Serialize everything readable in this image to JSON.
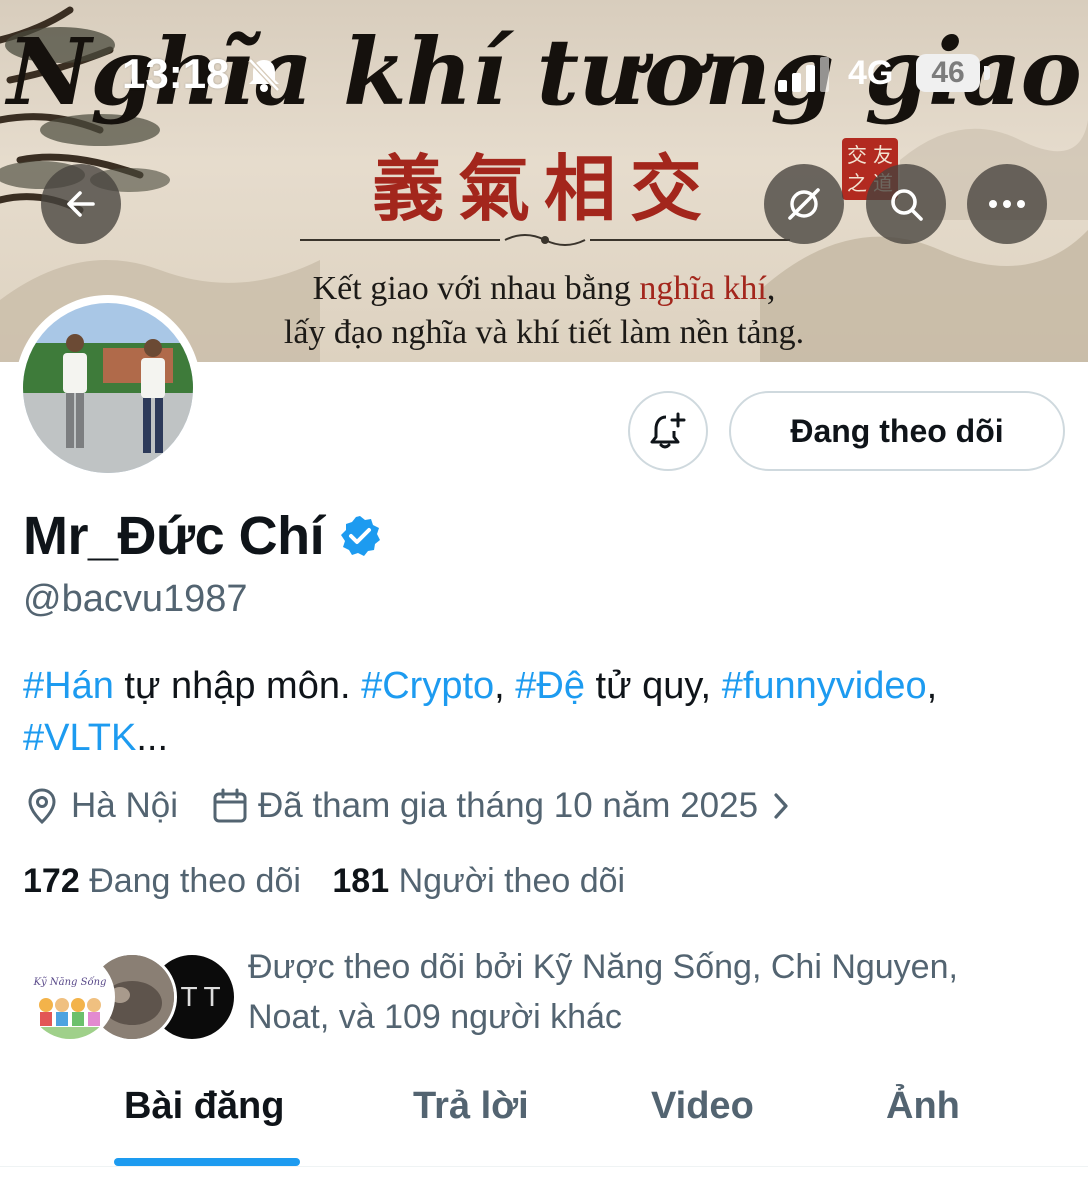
{
  "status_bar": {
    "time": "13:18",
    "network": "4G",
    "battery": "46"
  },
  "banner": {
    "title": "Nghĩa khí tương giao",
    "hanzi": "義氣相交",
    "seal_chars": [
      "交",
      "友",
      "之",
      "道"
    ],
    "line1_prefix": "Kết giao với nhau bằng ",
    "line1_highlight": "nghĩa khí",
    "line1_suffix": ",",
    "line2": "lấy đạo nghĩa và khí tiết làm nền tảng."
  },
  "nav": {
    "back_icon": "arrow-left-icon",
    "grok_icon": "grok-icon",
    "search_icon": "search-icon",
    "more_icon": "more-icon"
  },
  "actions": {
    "notify_icon": "bell-plus-icon",
    "following_label": "Đang theo dõi"
  },
  "profile": {
    "name": "Mr_Đức Chí",
    "handle": "@bacvu1987",
    "bio": [
      {
        "text": "#Hán",
        "tag": true
      },
      {
        "text": " tự nhập môn. ",
        "tag": false
      },
      {
        "text": "#Crypto",
        "tag": true
      },
      {
        "text": ", ",
        "tag": false
      },
      {
        "text": "#Đệ",
        "tag": true
      },
      {
        "text": " tử quy, ",
        "tag": false
      },
      {
        "text": "#funnyvideo",
        "tag": true
      },
      {
        "text": ", ",
        "tag": false
      },
      {
        "text": "#VLTK",
        "tag": true
      },
      {
        "text": "...",
        "tag": false
      }
    ],
    "location": "Hà Nội",
    "joined": "Đã tham gia tháng 10 năm 2025",
    "following_count": "172",
    "following_label": "Đang theo dõi",
    "followers_count": "181",
    "followers_label": "Người theo dõi",
    "followed_by_line1": "Được theo dõi bởi Kỹ Năng Sống, Chi Nguyen,",
    "followed_by_line2": "Noat, và 109 người khác",
    "followed_avatar1_text": "Kỹ Năng Sống",
    "followed_avatar3_text": "TTT"
  },
  "tabs": [
    {
      "label": "Bài đăng",
      "active": true
    },
    {
      "label": "Trả lời",
      "active": false
    },
    {
      "label": "Video",
      "active": false
    },
    {
      "label": "Ảnh",
      "active": false
    }
  ],
  "colors": {
    "accent": "#1d9bf0",
    "text": "#0f1419",
    "secondary": "#536471",
    "seal_red": "#a3261c"
  }
}
